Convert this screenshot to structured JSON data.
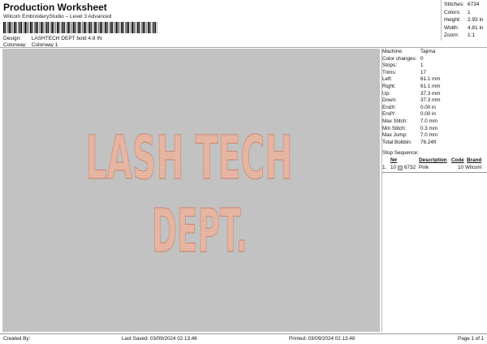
{
  "header": {
    "title": "Production Worksheet",
    "subtitle": "Wilcom EmbroideryStudio – Level 3 Advanced"
  },
  "meta": {
    "design_label": "Design:",
    "design_value": "LASHTECH DEPT bold 4.8 IN",
    "colorway_label": "Colorway:",
    "colorway_value": "Colorway 1"
  },
  "summary": [
    {
      "label": "Stitches:",
      "value": "6734"
    },
    {
      "label": "Colors:",
      "value": "1"
    },
    {
      "label": "Height:",
      "value": "2.93 in"
    },
    {
      "label": "Width:",
      "value": "4.81 in"
    },
    {
      "label": "Zoom:",
      "value": "1:1"
    }
  ],
  "design_text": {
    "line1": "LASH TECH",
    "line2": "DEPT.",
    "thread_color": "#e8b8a4",
    "thread_shade": "#c98f7a",
    "canvas_color": "#c2c2c2"
  },
  "specs": [
    {
      "label": "Machine:",
      "value": "Tajima"
    },
    {
      "label": "Color changes:",
      "value": "0"
    },
    {
      "label": "Stops:",
      "value": "1"
    },
    {
      "label": "Trims:",
      "value": "17"
    },
    {
      "label": "Left:",
      "value": "61.1 mm"
    },
    {
      "label": "Right:",
      "value": "61.1 mm"
    },
    {
      "label": "Up:",
      "value": "37.3 mm"
    },
    {
      "label": "Down:",
      "value": "37.3 mm"
    },
    {
      "label": "EndX:",
      "value": "0.00 in"
    },
    {
      "label": "EndY:",
      "value": "0.00 in"
    },
    {
      "label": "Max Stitch:",
      "value": "7.0 mm"
    },
    {
      "label": "Min Stitch:",
      "value": "0.3 mm"
    },
    {
      "label": "Max Jump:",
      "value": "7.0 mm"
    },
    {
      "label": "Total Bobbin:",
      "value": "76.24ft"
    }
  ],
  "stop_sequence": {
    "title": "Stop Sequence:",
    "headers": {
      "n": "N#",
      "description": "Description",
      "code": "Code",
      "brand": "Brand"
    },
    "rows": [
      {
        "index": "1.",
        "n": "10",
        "stitches": "6732",
        "description": "Pink",
        "code": "10",
        "brand": "Wilcom",
        "swatch": "#e8b8a4"
      }
    ]
  },
  "footer": {
    "created_by": "Created By:",
    "last_saved": "Last Saved: 03/09/2024 02.13.46",
    "printed": "Printed: 03/09/2024 02.13.48",
    "page": "Page 1 of 1"
  }
}
